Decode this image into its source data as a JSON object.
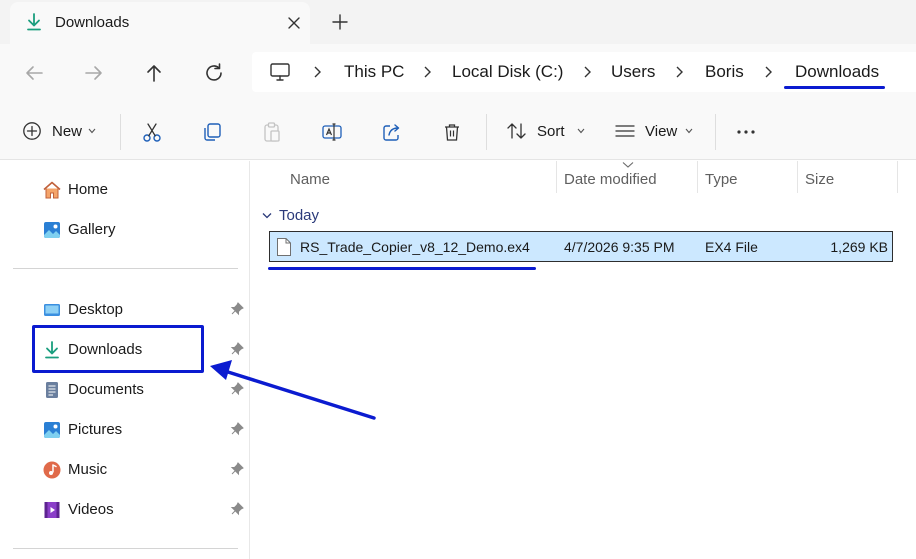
{
  "window": {
    "tab_title": "Downloads",
    "accent_color": "#0b1bd0",
    "selection_color": "#cce8ff"
  },
  "address_bar": {
    "crumbs": [
      "This PC",
      "Local Disk (C:)",
      "Users",
      "Boris",
      "Downloads"
    ]
  },
  "toolbar": {
    "new_label": "New",
    "sort_label": "Sort",
    "view_label": "View"
  },
  "sidebar": {
    "top_items": [
      {
        "label": "Home",
        "icon": "home-icon"
      },
      {
        "label": "Gallery",
        "icon": "gallery-icon"
      }
    ],
    "quick_access": [
      {
        "label": "Desktop",
        "icon": "desktop-folder-icon",
        "pinned": true
      },
      {
        "label": "Downloads",
        "icon": "download-icon",
        "pinned": true
      },
      {
        "label": "Documents",
        "icon": "documents-icon",
        "pinned": true
      },
      {
        "label": "Pictures",
        "icon": "pictures-icon",
        "pinned": true
      },
      {
        "label": "Music",
        "icon": "music-icon",
        "pinned": true
      },
      {
        "label": "Videos",
        "icon": "videos-icon",
        "pinned": true
      }
    ]
  },
  "file_list": {
    "columns": [
      "Name",
      "Date modified",
      "Type",
      "Size"
    ],
    "sorted_column": "Date modified",
    "groups": [
      {
        "label": "Today",
        "files": [
          {
            "name": "RS_Trade_Copier_v8_12_Demo.ex4",
            "date_modified": "4/7/2026 9:35 PM",
            "type": "EX4 File",
            "size": "1,269 KB",
            "selected": true
          }
        ]
      }
    ]
  }
}
